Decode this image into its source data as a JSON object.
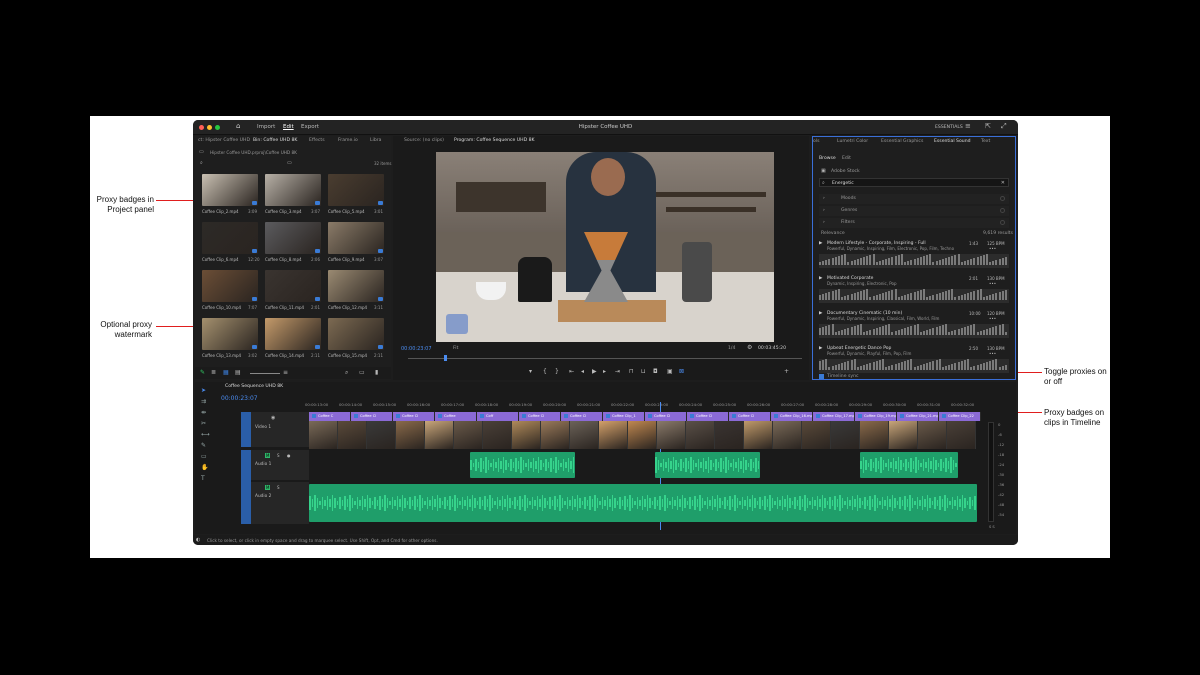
{
  "app": {
    "title": "Hipster Coffee UHD",
    "menus": [
      "Import",
      "Edit",
      "Export"
    ],
    "active_menu": "Edit",
    "workspace": "ESSENTIALS"
  },
  "project_panel": {
    "tabs": [
      "ct: Hipster Coffee UHD",
      "Bin: Coffee UHD 8K",
      "Effects",
      "Frame.io",
      "Libra"
    ],
    "active_tab": "Bin: Coffee UHD 8K",
    "path": "Hipster Coffee UHD.prproj\\Coffee UHD 8K",
    "item_count": "32 items",
    "clips": [
      {
        "name": "Coffee Clip_2.mp4",
        "dur": "3:09"
      },
      {
        "name": "Coffee Clip_3.mp4",
        "dur": "3:07"
      },
      {
        "name": "Coffee Clip_5.mp4",
        "dur": "3:01"
      },
      {
        "name": "Coffee Clip_6.mp4",
        "dur": "12:20"
      },
      {
        "name": "Coffee Clip_8.mp4",
        "dur": "2:06"
      },
      {
        "name": "Coffee Clip_9.mp4",
        "dur": "3:07"
      },
      {
        "name": "Coffee Clip_10.mp4",
        "dur": "7:07"
      },
      {
        "name": "Coffee Clip_11.mp4",
        "dur": "2:01"
      },
      {
        "name": "Coffee Clip_12.mp4",
        "dur": "3:11"
      },
      {
        "name": "Coffee Clip_13.mp4",
        "dur": "3:02"
      },
      {
        "name": "Coffee Clip_14.mp4",
        "dur": "2:11"
      },
      {
        "name": "Coffee Clip_15.mp4",
        "dur": "2:11"
      }
    ]
  },
  "program_monitor": {
    "source_tab": "Source: (no clips)",
    "program_tab": "Program: Coffee Sequence UHD 8K",
    "timecode": "00:00:23:07",
    "fit": "Fit",
    "resolution": "1/4",
    "duration": "00:03:45:20"
  },
  "sound_panel": {
    "tabs": [
      "ols",
      "Lumetri Color",
      "Essential Graphics",
      "Essential Sound",
      "Text"
    ],
    "active_tab": "Essential Sound",
    "subtabs": [
      "Browse",
      "Edit"
    ],
    "source": "Adobe Stock",
    "search": "Energetic",
    "filters": [
      "Moods",
      "Genres",
      "Filters"
    ],
    "sort": "Relevance",
    "results_count": "9,619 results",
    "results": [
      {
        "title": "Modern Lifestyle - Corporate, Inspiring - Full",
        "tags": "Powerful, Dynamic, Inspiring, Film, Electronic, Pop, Film, Techno",
        "time": "1:43",
        "bpm": "125 BPM"
      },
      {
        "title": "Motivated Corporate",
        "tags": "Dynamic, Inspiring, Electronic, Pop",
        "time": "2:01",
        "bpm": "130 BPM"
      },
      {
        "title": "Documentary Cinematic (10 min)",
        "tags": "Powerful, Dynamic, Inspiring, Classical, Film, World, Film",
        "time": "10:00",
        "bpm": "120 BPM"
      },
      {
        "title": "Upbeat Energetic Dance Pop",
        "tags": "Powerful, Dynamic, Playful, Film, Pop, Film",
        "time": "2:50",
        "bpm": "130 BPM"
      }
    ],
    "timeline_sync": "Timeline sync"
  },
  "timeline": {
    "sequence_tab": "Coffee Sequence UHD 8K",
    "timecode": "00:00:23:07",
    "ruler": [
      "00:00:13:00",
      "00:00:14:00",
      "00:00:15:00",
      "00:00:16:00",
      "00:00:17:00",
      "00:00:18:00",
      "00:00:19:00",
      "00:00:20:00",
      "00:00:21:00",
      "00:00:22:00",
      "00:00:23:00",
      "00:00:24:00",
      "00:00:25:00",
      "00:00:26:00",
      "00:00:27:00",
      "00:00:28:00",
      "00:00:29:00",
      "00:00:30:00",
      "00:00:31:00",
      "00:00:32:00"
    ],
    "clip_labels": [
      "Coffee C",
      "Coffee Cl",
      "Coffee Cl",
      "Coffee",
      "Coff",
      "Coffee Cl",
      "Coffee Cl",
      "Coffee Clip_1",
      "Coffee Cl",
      "Coffee Cl",
      "Coffee Cl",
      "Coffee Clip_16.mp4",
      "Coffee Clip_17.mp",
      "Coffee Clip_19.mp4",
      "Coffee Clip_21.mp4",
      "Coffee Clip_22"
    ],
    "tracks": {
      "v1": "V1",
      "video1": "Video 1",
      "a1": "A1",
      "audio1": "Audio 1",
      "a2": "A2",
      "audio2": "Audio 2"
    },
    "meter_scale": [
      "0",
      "-6",
      "-12",
      "-18",
      "-24",
      "-30",
      "-36",
      "-42",
      "-48",
      "-54"
    ],
    "meter_labels": "S  S"
  },
  "status_bar": "Click to select, or click in empty space and drag to marquee select. Use Shift, Opt, and Cmd for other options.",
  "callouts": {
    "proxy_project": "Proxy badges in Project panel",
    "watermark": "Optional proxy watermark",
    "toggle": "Toggle proxies on or off",
    "proxy_timeline": "Proxy badges on clips in Timeline"
  },
  "colors": {
    "accent_blue": "#3a7bd5",
    "clip_purple": "#8b6ad6",
    "audio_green": "#1f9e6a",
    "callout_red": "#e01e1e"
  }
}
